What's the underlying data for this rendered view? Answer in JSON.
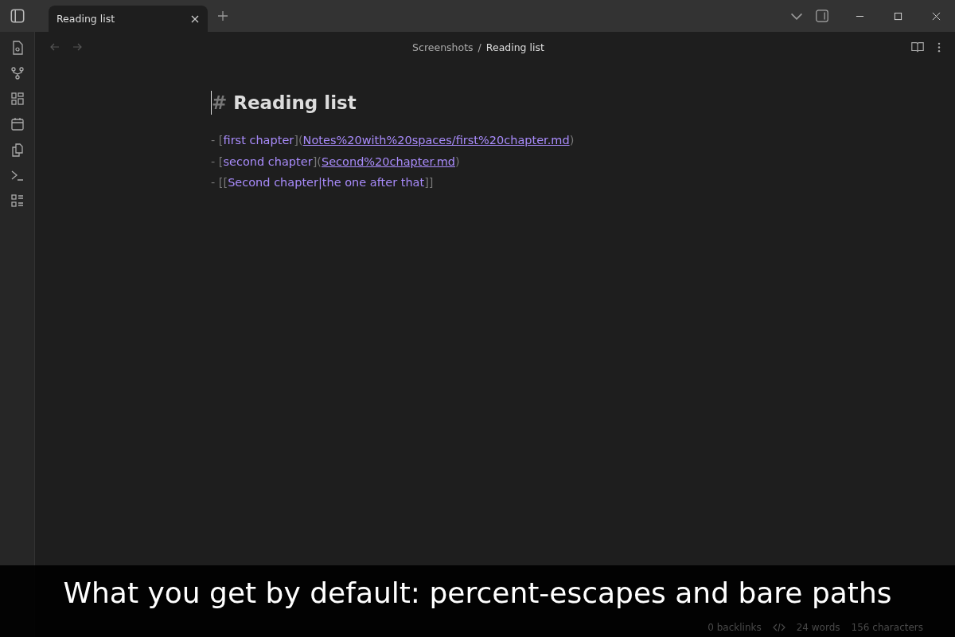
{
  "tabs": [
    {
      "label": "Reading list",
      "selected": true
    }
  ],
  "breadcrumb": {
    "folder": "Screenshots",
    "separator": "/",
    "file": "Reading list"
  },
  "heading": {
    "marker": "#",
    "text": "Reading list"
  },
  "lines": [
    {
      "segments": [
        {
          "kind": "punct",
          "text": "- ["
        },
        {
          "kind": "text",
          "text": "first chapter"
        },
        {
          "kind": "punct",
          "text": "]("
        },
        {
          "kind": "link",
          "text": "Notes%20with%20spaces/first%20chapter.md"
        },
        {
          "kind": "punct",
          "text": ")"
        }
      ]
    },
    {
      "segments": [
        {
          "kind": "punct",
          "text": "- ["
        },
        {
          "kind": "text",
          "text": "second chapter"
        },
        {
          "kind": "punct",
          "text": "]("
        },
        {
          "kind": "link",
          "text": "Second%20chapter.md"
        },
        {
          "kind": "punct",
          "text": ")"
        }
      ]
    },
    {
      "segments": [
        {
          "kind": "punct",
          "text": "- [["
        },
        {
          "kind": "text",
          "text": "Second chapter|the one after that"
        },
        {
          "kind": "punct",
          "text": "]]"
        }
      ]
    }
  ],
  "status_bar": {
    "backlinks": "0 backlinks",
    "words": "24 words",
    "characters": "156 characters"
  },
  "caption": "What you get by default: percent-escapes and bare paths"
}
